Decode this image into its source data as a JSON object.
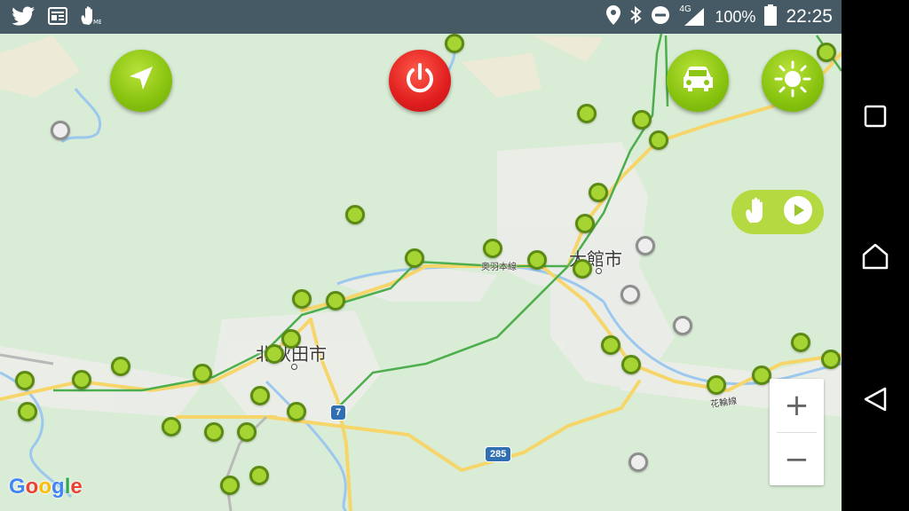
{
  "status_bar": {
    "left_icons": [
      "twitter-icon",
      "news-icon",
      "hand-app-icon"
    ],
    "network_type": "4G",
    "battery_percent": "100%",
    "time": "22:25"
  },
  "map": {
    "city_labels": [
      {
        "text": "大館市",
        "key": "odate"
      },
      {
        "text": "北秋田市",
        "key": "kitaakita"
      }
    ],
    "rail_labels": [
      "奥羽本線",
      "花輪線"
    ],
    "route_shields": [
      "7",
      "285"
    ],
    "attribution": "Google",
    "markers_green": 33,
    "markers_gray": 6
  },
  "controls": {
    "navigate_icon": "compass-arrow-icon",
    "power_icon": "power-icon",
    "car_icon": "car-icon",
    "brightness_icon": "sun-icon",
    "pill_icons": [
      "hand-icon",
      "play-icon"
    ],
    "zoom_in": "+",
    "zoom_out": "−",
    "colors": {
      "green_button": "#86c20e",
      "red_button": "#e01e1e",
      "status_bar": "#455a64",
      "marker_green": "#a6d433",
      "marker_gray": "#eeeeee"
    }
  },
  "nav_bar": {
    "buttons": [
      "recents-button",
      "home-button",
      "back-button"
    ]
  }
}
